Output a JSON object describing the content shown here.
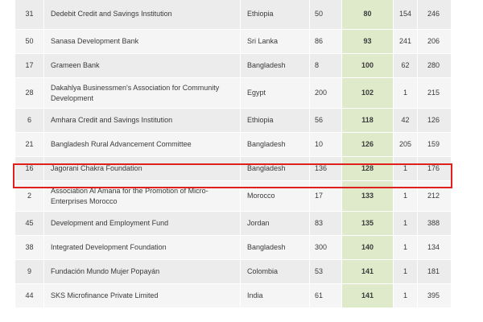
{
  "table": {
    "rows": [
      {
        "id": "31",
        "name": "Dedebit Credit and Savings Institution",
        "country": "Ethiopia",
        "a": "50",
        "score": "80",
        "c": "154",
        "d": "246"
      },
      {
        "id": "50",
        "name": "Sanasa Development Bank",
        "country": "Sri Lanka",
        "a": "86",
        "score": "93",
        "c": "241",
        "d": "206"
      },
      {
        "id": "17",
        "name": "Grameen Bank",
        "country": "Bangladesh",
        "a": "8",
        "score": "100",
        "c": "62",
        "d": "280"
      },
      {
        "id": "28",
        "name": "Dakahlya Businessmen's Association for Community Development",
        "country": "Egypt",
        "a": "200",
        "score": "102",
        "c": "1",
        "d": "215"
      },
      {
        "id": "6",
        "name": "Amhara Credit and Savings Institution",
        "country": "Ethiopia",
        "a": "56",
        "score": "118",
        "c": "42",
        "d": "126"
      },
      {
        "id": "21",
        "name": "Bangladesh Rural Advancement Committee",
        "country": "Bangladesh",
        "a": "10",
        "score": "126",
        "c": "205",
        "d": "159"
      },
      {
        "id": "16",
        "name": "Jagorani Chakra Foundation",
        "country": "Bangladesh",
        "a": "136",
        "score": "128",
        "c": "1",
        "d": "176"
      },
      {
        "id": "2",
        "name": "Association Al Amana for the Promotion of Micro-Enterprises Morocco",
        "country": "Morocco",
        "a": "17",
        "score": "133",
        "c": "1",
        "d": "212"
      },
      {
        "id": "45",
        "name": "Development and Employment Fund",
        "country": "Jordan",
        "a": "83",
        "score": "135",
        "c": "1",
        "d": "388"
      },
      {
        "id": "38",
        "name": "Integrated Development Foundation",
        "country": "Bangladesh",
        "a": "300",
        "score": "140",
        "c": "1",
        "d": "134"
      },
      {
        "id": "9",
        "name": "Fundación Mundo Mujer Popayán",
        "country": "Colombia",
        "a": "53",
        "score": "141",
        "c": "1",
        "d": "181"
      },
      {
        "id": "44",
        "name": "SKS Microfinance Private Limited",
        "country": "India",
        "a": "61",
        "score": "141",
        "c": "1",
        "d": "395"
      }
    ]
  },
  "highlight": {
    "row_index": 6,
    "color": "#e0201c"
  },
  "colors": {
    "score_column_bg": "#dfeacb",
    "row_odd": "#ececec",
    "row_even": "#f5f5f5"
  }
}
